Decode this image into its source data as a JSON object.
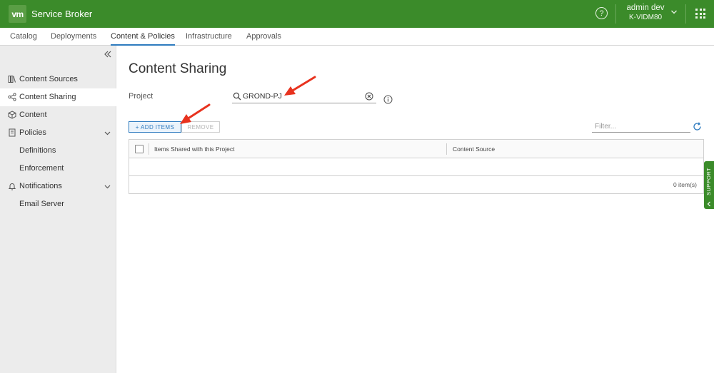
{
  "header": {
    "logo_text": "vm",
    "app_title": "Service Broker",
    "help_icon": "help-circle-icon",
    "user_name": "admin dev",
    "user_org": "K-VIDM80",
    "apps_icon": "app-grid-icon",
    "bg_color": "#3b8b2a"
  },
  "nav": {
    "tabs": [
      {
        "label": "Catalog"
      },
      {
        "label": "Deployments"
      },
      {
        "label": "Content & Policies",
        "active": true
      },
      {
        "label": "Infrastructure"
      },
      {
        "label": "Approvals"
      }
    ],
    "active_color": "#2e7bbf"
  },
  "sidebar": {
    "items": [
      {
        "label": "Content Sources",
        "icon": "book-icon"
      },
      {
        "label": "Content Sharing",
        "icon": "share-icon",
        "active": true
      },
      {
        "label": "Content",
        "icon": "cube-icon"
      },
      {
        "label": "Policies",
        "icon": "document-icon",
        "expandable": true
      },
      {
        "label": "Definitions"
      },
      {
        "label": "Enforcement"
      },
      {
        "label": "Notifications",
        "icon": "bell-icon",
        "expandable": true
      },
      {
        "label": "Email Server"
      }
    ]
  },
  "main": {
    "title": "Content Sharing",
    "project_label": "Project",
    "project_value": "GROND-PJ",
    "add_button": "+ ADD ITEMS",
    "remove_button": "REMOVE",
    "filter_placeholder": "Filter...",
    "table": {
      "columns": [
        "Items Shared with this Project",
        "Content Source"
      ],
      "footer": "0 item(s)"
    }
  },
  "support_tab": "SUPPORT",
  "annotation_color": "#e8321e"
}
